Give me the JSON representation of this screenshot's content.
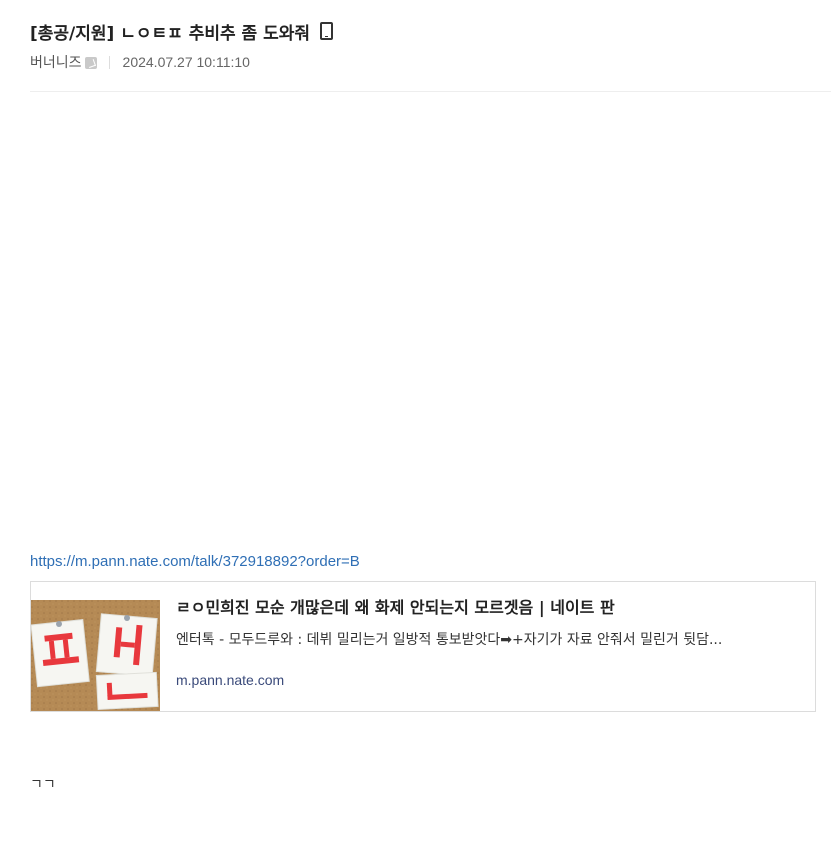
{
  "post": {
    "title": "[총공/지원] ㄴㅇㅌㅍ 추비추 좀 도와줘",
    "author": "버너니즈",
    "date": "2024.07.27 10:11:10",
    "link_url": "https://m.pann.nate.com/talk/372918892?order=B",
    "body_text": "ㄱㄱ"
  },
  "link_preview": {
    "title": "ㄹㅇ민희진 모순 개많은데 왜 화제 안되는지 모르겟음 | 네이트 판",
    "description": "엔터톡 - 모두드루와 : 데뷔 밀리는거 일방적 통보받앗다➡+자기가 자료 안줘서 밀린거 뒷담...",
    "domain": "m.pann.nate.com",
    "thumb_text": "판"
  },
  "icons": {
    "device": "mobile-phone-icon",
    "author_badge": "user-badge-icon"
  },
  "colors": {
    "link": "#2f6fb5",
    "thumb_accent": "#e8383d",
    "thumb_board": "#b58a55"
  }
}
